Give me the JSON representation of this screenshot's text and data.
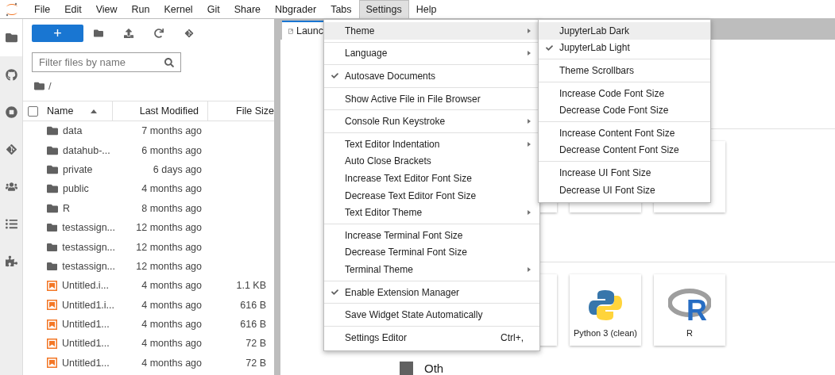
{
  "menubar": [
    {
      "label": "File",
      "selected": false
    },
    {
      "label": "Edit",
      "selected": false
    },
    {
      "label": "View",
      "selected": false
    },
    {
      "label": "Run",
      "selected": false
    },
    {
      "label": "Kernel",
      "selected": false
    },
    {
      "label": "Git",
      "selected": false
    },
    {
      "label": "Share",
      "selected": false
    },
    {
      "label": "Nbgrader",
      "selected": false
    },
    {
      "label": "Tabs",
      "selected": false
    },
    {
      "label": "Settings",
      "selected": true
    },
    {
      "label": "Help",
      "selected": false
    }
  ],
  "activity_bar": [
    {
      "selected": true
    },
    {
      "selected": false
    },
    {
      "selected": false
    },
    {
      "selected": false
    },
    {
      "selected": false
    },
    {
      "selected": false
    },
    {
      "selected": false
    }
  ],
  "file_browser": {
    "new_button": "+",
    "filter": {
      "placeholder": "Filter files by name"
    },
    "breadcrumb": "/",
    "header": {
      "checked": false,
      "columns": [
        "Name",
        "Last Modified",
        "File Size"
      ]
    },
    "rows": [
      {
        "kind": "folder",
        "name": "data",
        "modified": "7 months ago"
      },
      {
        "kind": "folder",
        "name": "datahub-...",
        "modified": "6 months ago"
      },
      {
        "kind": "folder",
        "name": "private",
        "modified": "6 days ago"
      },
      {
        "kind": "folder",
        "name": "public",
        "modified": "4 months ago"
      },
      {
        "kind": "folder",
        "name": "R",
        "modified": "8 months ago"
      },
      {
        "kind": "folder",
        "name": "testassign...",
        "modified": "12 months ago"
      },
      {
        "kind": "folder",
        "name": "testassign...",
        "modified": "12 months ago"
      },
      {
        "kind": "folder",
        "name": "testassign...",
        "modified": "12 months ago"
      },
      {
        "kind": "notebook",
        "name": "Untitled.i...",
        "modified": "4 months ago",
        "size": "1.1 KB"
      },
      {
        "kind": "notebook",
        "name": "Untitled1.i...",
        "modified": "4 months ago",
        "size": "616 B"
      },
      {
        "kind": "notebook",
        "name": "Untitled1...",
        "modified": "4 months ago",
        "size": "616 B"
      },
      {
        "kind": "notebook",
        "name": "Untitled1...",
        "modified": "4 months ago",
        "size": "72 B"
      },
      {
        "kind": "notebook",
        "name": "Untitled1...",
        "modified": "4 months ago",
        "size": "72 B"
      }
    ]
  },
  "tab": {
    "label": "Launc"
  },
  "launcher": {
    "sections": [
      {
        "cards": [
          {
            "kind": "covered"
          },
          {
            "kind": "covered"
          },
          {
            "kind": "covered"
          }
        ]
      },
      {
        "cards": [
          {
            "kind": "covered"
          },
          {
            "kind": "python",
            "label": "Python 3 (clean)"
          },
          {
            "kind": "r",
            "label": "R",
            "logo": "R"
          }
        ]
      }
    ],
    "next_heading": "Oth"
  },
  "settings_menu": {
    "sections": [
      [
        {
          "label": "Theme",
          "submenu": true,
          "checked": false,
          "selected": true
        }
      ],
      [
        {
          "label": "Language",
          "submenu": true,
          "checked": false,
          "selected": false
        }
      ],
      [
        {
          "label": "Autosave Documents",
          "submenu": false,
          "checked": true,
          "selected": false
        }
      ],
      [
        {
          "label": "Show Active File in File Browser",
          "submenu": false,
          "checked": false,
          "selected": false
        }
      ],
      [
        {
          "label": "Console Run Keystroke",
          "submenu": true,
          "checked": false,
          "selected": false
        }
      ],
      [
        {
          "label": "Text Editor Indentation",
          "submenu": true,
          "checked": false,
          "selected": false
        },
        {
          "label": "Auto Close Brackets",
          "submenu": false,
          "checked": false,
          "selected": false
        },
        {
          "label": "Increase Text Editor Font Size",
          "submenu": false,
          "checked": false,
          "selected": false
        },
        {
          "label": "Decrease Text Editor Font Size",
          "submenu": false,
          "checked": false,
          "selected": false
        },
        {
          "label": "Text Editor Theme",
          "submenu": true,
          "checked": false,
          "selected": false
        }
      ],
      [
        {
          "label": "Increase Terminal Font Size",
          "submenu": false,
          "checked": false,
          "selected": false
        },
        {
          "label": "Decrease Terminal Font Size",
          "submenu": false,
          "checked": false,
          "selected": false
        },
        {
          "label": "Terminal Theme",
          "submenu": true,
          "checked": false,
          "selected": false
        }
      ],
      [
        {
          "label": "Enable Extension Manager",
          "submenu": false,
          "checked": true,
          "selected": false
        }
      ],
      [
        {
          "label": "Save Widget State Automatically",
          "submenu": false,
          "checked": false,
          "selected": false
        }
      ],
      [
        {
          "label": "Settings Editor",
          "submenu": false,
          "checked": false,
          "selected": false,
          "shortcut": "Ctrl+,"
        }
      ]
    ]
  },
  "theme_submenu": {
    "sections": [
      [
        {
          "label": "JupyterLab Dark",
          "checked": false,
          "selected": true
        },
        {
          "label": "JupyterLab Light",
          "checked": true,
          "selected": false
        }
      ],
      [
        {
          "label": "Theme Scrollbars",
          "checked": false,
          "selected": false
        }
      ],
      [
        {
          "label": "Increase Code Font Size",
          "checked": false,
          "selected": false
        },
        {
          "label": "Decrease Code Font Size",
          "checked": false,
          "selected": false
        }
      ],
      [
        {
          "label": "Increase Content Font Size",
          "checked": false,
          "selected": false
        },
        {
          "label": "Decrease Content Font Size",
          "checked": false,
          "selected": false
        }
      ],
      [
        {
          "label": "Increase UI Font Size",
          "checked": false,
          "selected": false
        },
        {
          "label": "Decrease UI Font Size",
          "checked": false,
          "selected": false
        }
      ]
    ]
  }
}
